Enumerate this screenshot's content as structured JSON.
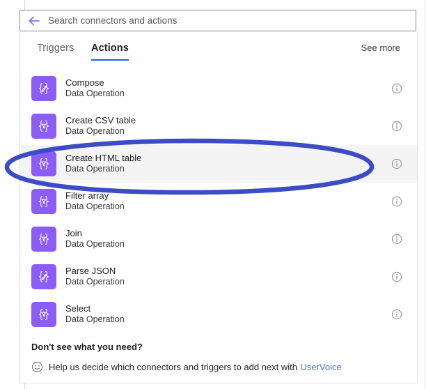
{
  "search": {
    "placeholder": "Search connectors and actions",
    "value": "",
    "back_icon": "back-arrow-icon"
  },
  "tabs": [
    {
      "label": "Triggers",
      "active": false
    },
    {
      "label": "Actions",
      "active": true
    }
  ],
  "see_more_label": "See more",
  "actions": [
    {
      "title": "Compose",
      "subtitle": "Data Operation",
      "icon": "braces-pencil-icon",
      "highlighted": false
    },
    {
      "title": "Create CSV table",
      "subtitle": "Data Operation",
      "icon": "braces-funnel-icon",
      "highlighted": false
    },
    {
      "title": "Create HTML table",
      "subtitle": "Data Operation",
      "icon": "braces-funnel-icon",
      "highlighted": true
    },
    {
      "title": "Filter array",
      "subtitle": "Data Operation",
      "icon": "braces-funnel-icon",
      "highlighted": false
    },
    {
      "title": "Join",
      "subtitle": "Data Operation",
      "icon": "braces-funnel-icon",
      "highlighted": false
    },
    {
      "title": "Parse JSON",
      "subtitle": "Data Operation",
      "icon": "braces-pencil-icon",
      "highlighted": false
    },
    {
      "title": "Select",
      "subtitle": "Data Operation",
      "icon": "braces-funnel-icon",
      "highlighted": false
    }
  ],
  "info_icon_label": "info-icon",
  "footer": {
    "heading": "Don't see what you need?",
    "text": "Help us decide which connectors and triggers to add next with",
    "link_label": "UserVoice",
    "smiley_icon": "smiley-icon"
  },
  "annotation": {
    "shape": "ellipse",
    "target": "Create HTML table",
    "color": "#3b4cc4"
  },
  "colors": {
    "icon_purple": "#8b5cf6",
    "tab_underline": "#2563d9",
    "link_blue": "#4a6fd4",
    "row_highlight": "#f4f4f4",
    "annotation_blue": "#3b4cc4"
  }
}
